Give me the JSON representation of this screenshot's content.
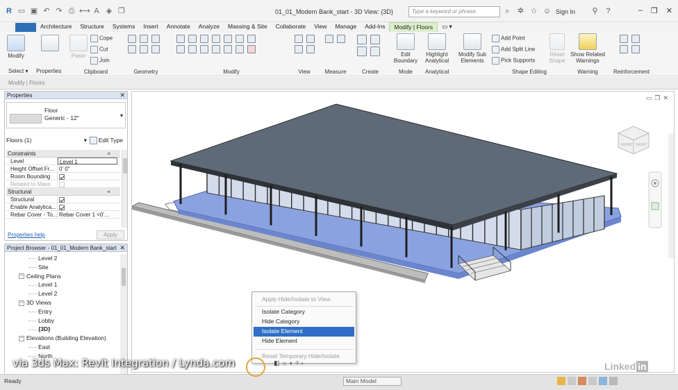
{
  "window": {
    "title": "01_01_Modern Bank_start - 3D View: {3D}",
    "search_placeholder": "Type a keyword or phrase",
    "sign_in": "Sign In"
  },
  "tabs": [
    "Architecture",
    "Structure",
    "Systems",
    "Insert",
    "Annotate",
    "Analyze",
    "Massing & Site",
    "Collaborate",
    "View",
    "Manage",
    "Add-Ins",
    "Modify | Floors"
  ],
  "active_tab": "Modify | Floors",
  "ribbon": {
    "select": {
      "modify": "Modify",
      "select": "Select",
      "properties": "Properties"
    },
    "clipboard": {
      "paste": "Paste",
      "cope": "Cope",
      "cut": "Cut",
      "join": "Join",
      "label": "Clipboard"
    },
    "group_labels": [
      "Geometry",
      "Modify",
      "View",
      "Measure",
      "Create",
      "Mode",
      "Analytical",
      "Shape Editing",
      "Warning",
      "Reinforcement"
    ],
    "mode": {
      "edit_boundary": "Edit Boundary"
    },
    "analytical": {
      "highlight": "Highlight Analytical"
    },
    "modify_sub": "Modify Sub Elements",
    "shape_editing": {
      "add_point": "Add Point",
      "add_split_line": "Add Split Line",
      "pick_supports": "Pick Supports",
      "reset_shape": "Reset Shape"
    },
    "warning": {
      "show_related": "Show Related Warnings"
    }
  },
  "modify_bar": "Modify | Floors",
  "properties": {
    "title": "Properties",
    "type_family": "Floor",
    "type_name": "Generic - 12\"",
    "instance": "Floors (1)",
    "edit_type": "Edit Type",
    "sections": [
      {
        "name": "Constraints",
        "rows": [
          {
            "key": "Level",
            "value": "Level 1",
            "kind": "box"
          },
          {
            "key": "Height Offset Fr...",
            "value": "0' 0\"",
            "kind": "text"
          },
          {
            "key": "Room Bounding",
            "value": "",
            "kind": "check"
          },
          {
            "key": "Related to Mass",
            "value": "",
            "kind": "check-dim"
          }
        ]
      },
      {
        "name": "Structural",
        "rows": [
          {
            "key": "Structural",
            "value": "",
            "kind": "check"
          },
          {
            "key": "Enable Analytica...",
            "value": "",
            "kind": "check"
          },
          {
            "key": "Rebar Cover - To...",
            "value": "Rebar Cover 1 <0'...",
            "kind": "text"
          }
        ]
      }
    ],
    "help": "Properties help",
    "apply": "Apply"
  },
  "browser": {
    "title": "Project Browser - 01_01_Modern Bank_start",
    "items": [
      {
        "label": "Level 2",
        "indent": 3,
        "toggle": ""
      },
      {
        "label": "Site",
        "indent": 3,
        "toggle": ""
      },
      {
        "label": "Ceiling Plans",
        "indent": 2,
        "toggle": "−"
      },
      {
        "label": "Level 1",
        "indent": 3,
        "toggle": ""
      },
      {
        "label": "Level 2",
        "indent": 3,
        "toggle": ""
      },
      {
        "label": "3D Views",
        "indent": 2,
        "toggle": "−"
      },
      {
        "label": "Entry",
        "indent": 3,
        "toggle": ""
      },
      {
        "label": "Lobby",
        "indent": 3,
        "toggle": ""
      },
      {
        "label": "{3D}",
        "indent": 3,
        "toggle": "",
        "bold": true
      },
      {
        "label": "Elevations (Building Elevation)",
        "indent": 2,
        "toggle": "−"
      },
      {
        "label": "East",
        "indent": 3,
        "toggle": ""
      },
      {
        "label": "North",
        "indent": 3,
        "toggle": ""
      }
    ]
  },
  "viewcube": {
    "front": "FRONT",
    "right": "RIGHT"
  },
  "context_menu": {
    "items": [
      {
        "label": "Apply Hide/Isolate to View",
        "state": "disabled"
      },
      {
        "label": "Isolate Category",
        "state": "normal"
      },
      {
        "label": "Hide Category",
        "state": "normal"
      },
      {
        "label": "Isolate Element",
        "state": "selected"
      },
      {
        "label": "Hide Element",
        "state": "normal"
      },
      {
        "label": "Reset Temporary Hide/Isolate",
        "state": "disabled"
      }
    ]
  },
  "status": {
    "ready": "Ready",
    "model": "Main Model"
  },
  "overlay": {
    "caption": "via 3ds Max: Revit Integration / Lynda.com",
    "brand": "Linked",
    "brand_in": "in"
  },
  "colors": {
    "accent_tab": "#dcefcd",
    "menu_highlight": "#2f6fc7",
    "roof": "#5c6775",
    "floor_slab": "#7a96d8",
    "glass": "#c7d2e8"
  }
}
